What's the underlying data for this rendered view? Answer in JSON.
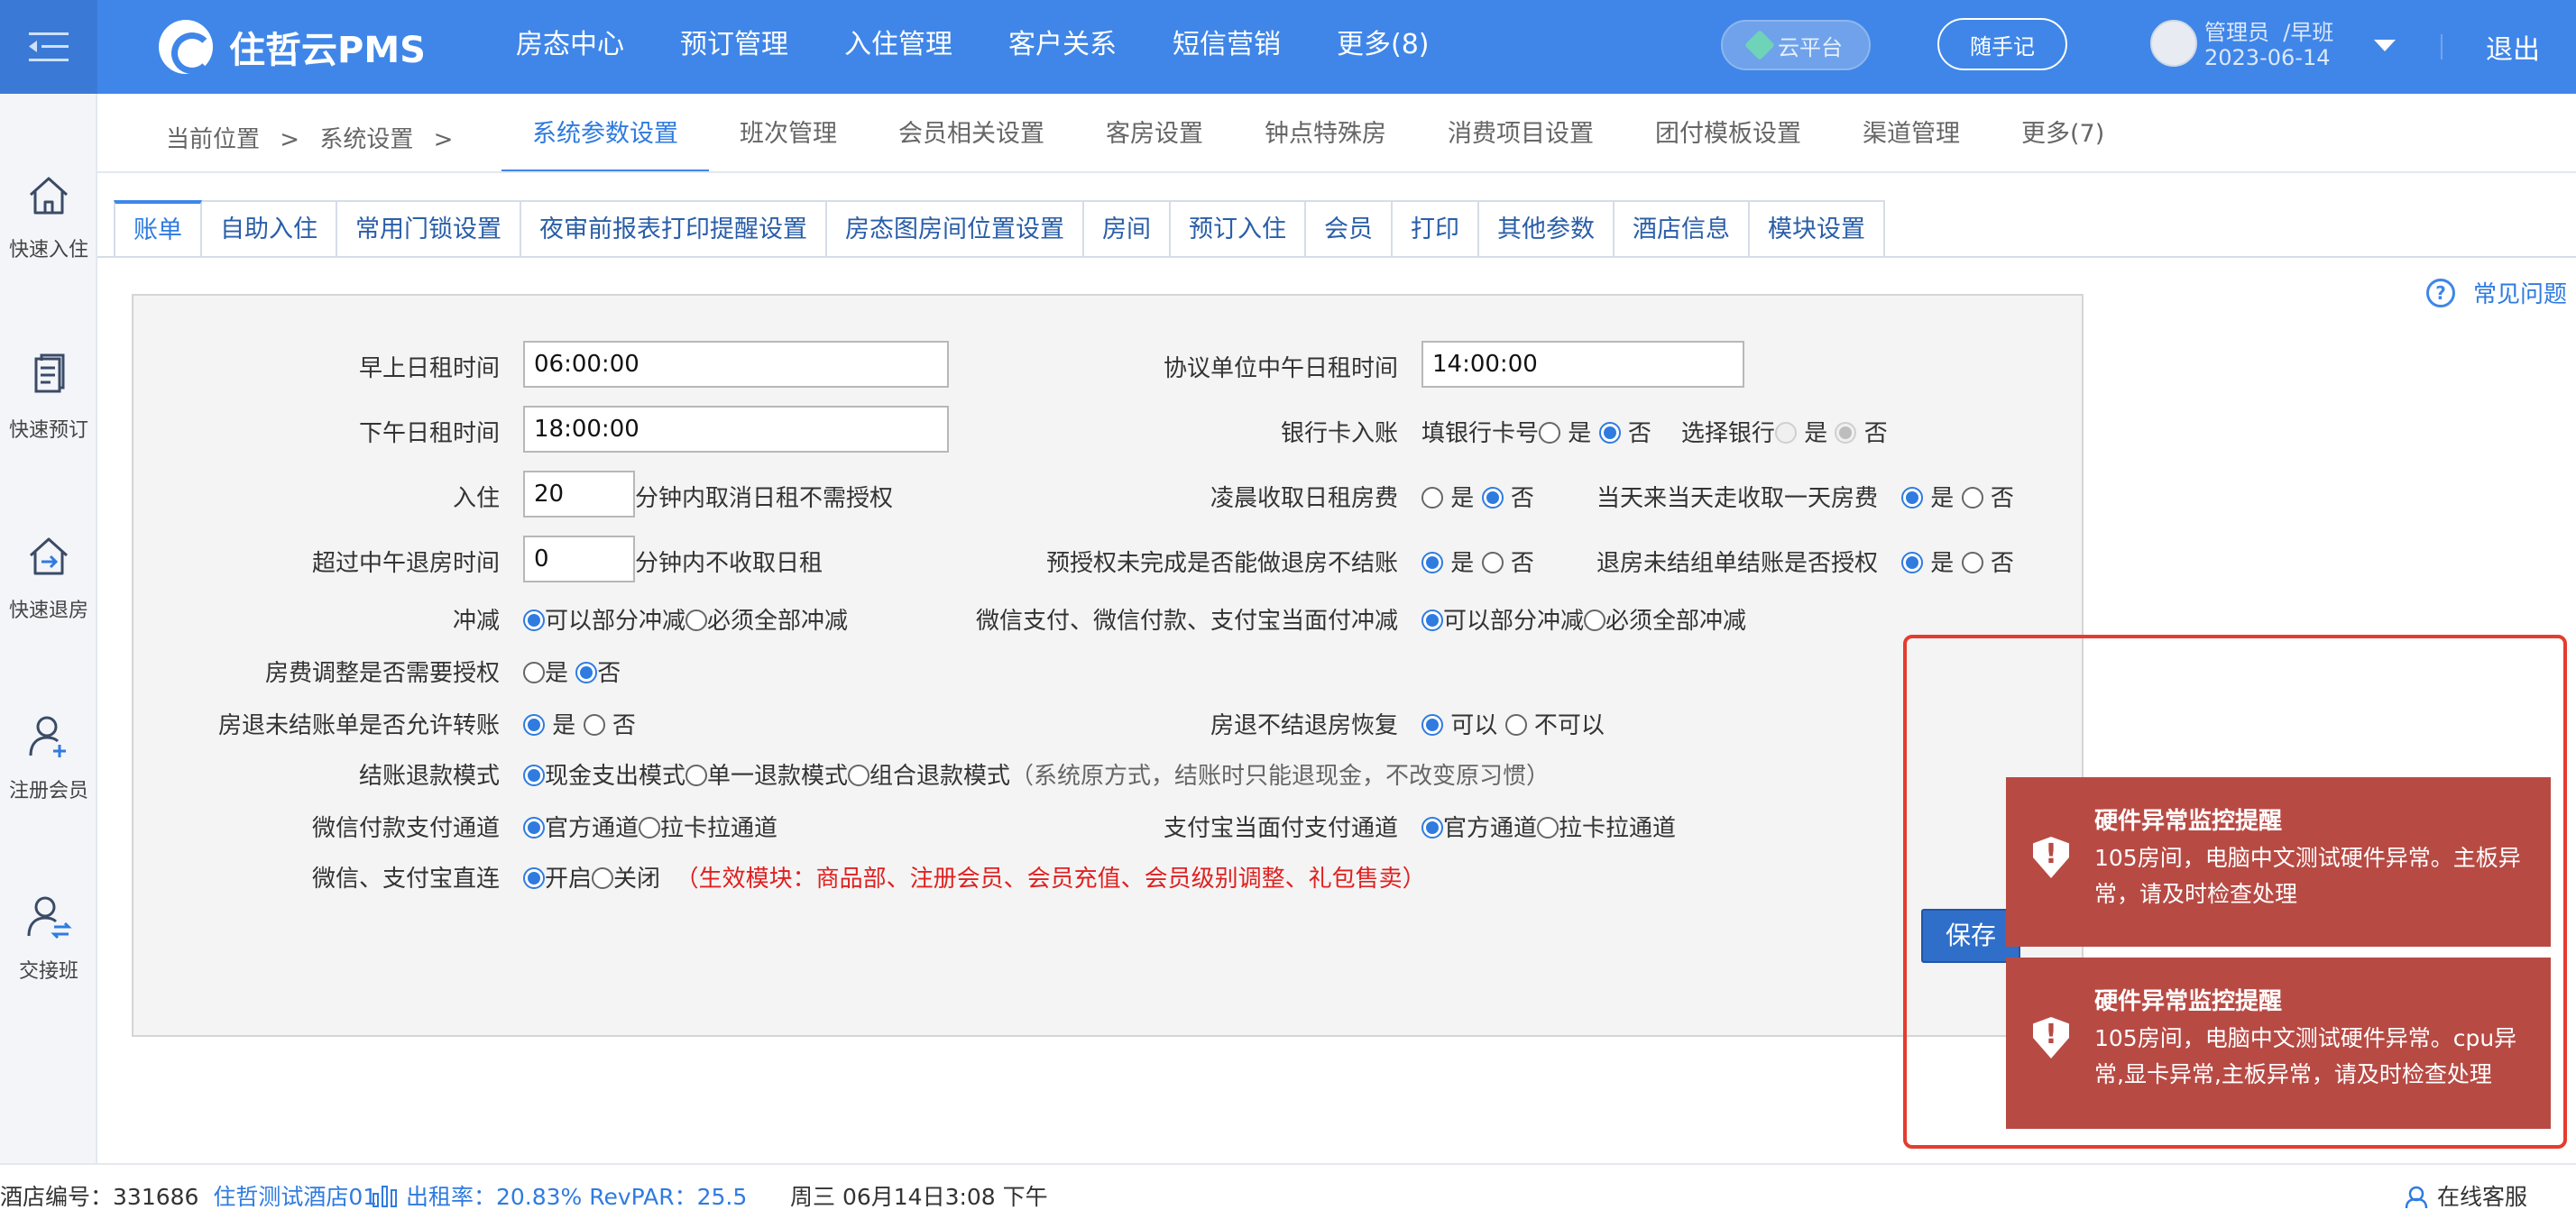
{
  "topbar": {
    "app_name": "住哲云PMS",
    "nav": [
      "房态中心",
      "预订管理",
      "入住管理",
      "客户关系",
      "短信营销",
      "更多(8)"
    ],
    "cloud_btn": "云平台",
    "note_btn": "随手记",
    "user_name": "管理员",
    "user_shift": "/早班",
    "user_date": "2023-06-14",
    "logout": "退出"
  },
  "sidebar": [
    "快速入住",
    "快速预订",
    "快速退房",
    "注册会员",
    "交接班"
  ],
  "breadcrumb": {
    "label": "当前位置",
    "sep": ">",
    "item": "系统设置",
    "sep2": ">"
  },
  "subnav": [
    "系统参数设置",
    "班次管理",
    "会员相关设置",
    "客房设置",
    "钟点特殊房",
    "消费项目设置",
    "团付模板设置",
    "渠道管理",
    "更多(7)"
  ],
  "tabs": [
    "账单",
    "自助入住",
    "常用门锁设置",
    "夜审前报表打印提醒设置",
    "房态图房间位置设置",
    "房间",
    "预订入住",
    "会员",
    "打印",
    "其他参数",
    "酒店信息",
    "模块设置"
  ],
  "faq": "常见问题",
  "form": {
    "morning_label": "早上日租时间",
    "morning_value": "06:00:00",
    "afternoon_label": "下午日租时间",
    "afternoon_value": "18:00:00",
    "checkin_label": "入住",
    "checkin_value": "20",
    "checkin_suffix": "分钟内取消日租不需授权",
    "noon_label": "超过中午退房时间",
    "noon_value": "0",
    "noon_suffix": "分钟内不收取日租",
    "offset_label": "冲减",
    "offset_opt1": "可以部分冲减",
    "offset_opt2": "必须全部冲减",
    "fee_adjust_label": "房费调整是否需要授权",
    "yes": "是",
    "no": "否",
    "transfer_label": "房退未结账单是否允许转账",
    "refund_label": "结账退款模式",
    "refund_opt1": "现金支出模式",
    "refund_opt2": "单一退款模式",
    "refund_opt3": "组合退款模式",
    "refund_note": "（系统原方式，结账时只能退现金，不改变原习惯）",
    "wechat_channel_label": "微信付款支付通道",
    "channel_opt1": "官方通道",
    "channel_opt2": "拉卡拉通道",
    "direct_label": "微信、支付宝直连",
    "direct_on": "开启",
    "direct_off": "关闭",
    "direct_note": "（生效模块：商品部、注册会员、会员充值、会员级别调整、礼包售卖）",
    "agreement_label": "协议单位中午日租时间",
    "agreement_value": "14:00:00",
    "bankcard_label": "银行卡入账",
    "bankcard_fill": "填银行卡号",
    "bankcard_select": "选择银行",
    "dawn_label": "凌晨收取日租房费",
    "sameday_label": "当天来当天走收取一天房费",
    "preauth_label": "预授权未完成是否能做退房不结账",
    "group_label": "退房未结组单结账是否授权",
    "mobile_offset_label": "微信支付、微信付款、支付宝当面付冲减",
    "restore_label": "房退不结退房恢复",
    "restore_yes": "可以",
    "restore_no": "不可以",
    "alipay_channel_label": "支付宝当面付支付通道"
  },
  "save_label": "保存",
  "toasts": [
    {
      "title": "硬件异常监控提醒",
      "body": "105房间，电脑中文测试硬件异常。主板异常，请及时检查处理"
    },
    {
      "title": "硬件异常监控提醒",
      "body": "105房间，电脑中文测试硬件异常。cpu异常,显卡异常,主板异常，请及时检查处理"
    }
  ],
  "statusbar": {
    "hotel_no_label": "酒店编号：",
    "hotel_no": "331686",
    "hotel_name": "住哲测试酒店01",
    "occupancy": "出租率：20.83%",
    "revpar": "RevPAR：25.5",
    "datetime": "周三 06月14日3:08 下午",
    "service": "在线客服"
  },
  "colors": {
    "primary": "#3f86e8",
    "toast": "#b84a44",
    "toast_frame": "#e53c2f",
    "note_red": "#e02020"
  }
}
